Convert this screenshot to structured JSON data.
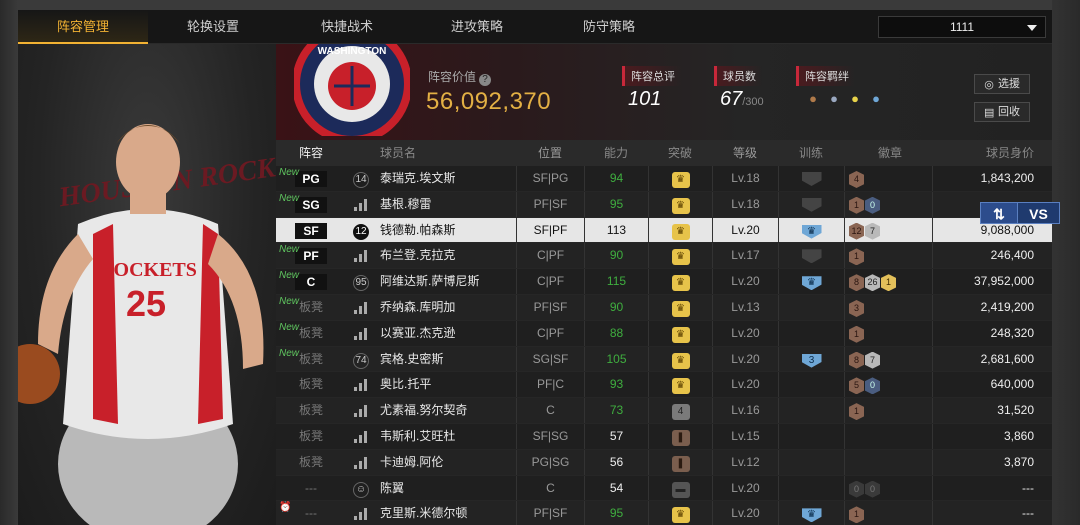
{
  "tabs": [
    {
      "label": "阵容管理",
      "active": true
    },
    {
      "label": "轮换设置",
      "active": false
    },
    {
      "label": "快捷战术",
      "active": false
    },
    {
      "label": "进攻策略",
      "active": false
    },
    {
      "label": "防守策略",
      "active": false
    }
  ],
  "lineup_select": {
    "value": "1111"
  },
  "team": {
    "logo_text": "WASHINGTON",
    "jersey_team": "ROCKETS",
    "jersey_number": "25",
    "bg_text": "HOUSTON ROCKETS"
  },
  "summary": {
    "value_label": "阵容价值",
    "value": "56,092,370",
    "rating_label": "阵容总评",
    "rating": "101",
    "players_label": "球员数",
    "players": "67",
    "players_max": "/300",
    "chem_label": "阵容羁绊"
  },
  "buttons": {
    "scout": "选援",
    "recycle": "回收"
  },
  "columns": [
    "阵容",
    "球员名",
    "位置",
    "能力",
    "突破",
    "等级",
    "训练",
    "徽章",
    "球员身价"
  ],
  "colors": {
    "accent": "#f2b233",
    "value_gold": "#e3b044",
    "ovr_green": "#3fae3f",
    "selected_row": "#e6e6e6",
    "vs_blue": "#2c4c8c"
  },
  "vs": {
    "swap": "⇅",
    "label": "VS"
  },
  "rows": [
    {
      "new": "New",
      "slot": "PG",
      "num": "14",
      "name": "泰瑞克.埃文斯",
      "pos": "SF|PG",
      "ovr": "94",
      "ovr_color": "green",
      "brk": "crown-gold",
      "lv": "Lv.18",
      "train": "dim",
      "badges": [
        {
          "t": "bronze",
          "n": "4"
        }
      ],
      "value": "1,843,200"
    },
    {
      "new": "New",
      "slot": "SG",
      "num": "sig",
      "name": "基根.穆雷",
      "pos": "PF|SF",
      "ovr": "95",
      "ovr_color": "green",
      "brk": "crown-gold",
      "lv": "Lv.18",
      "train": "dim",
      "badges": [
        {
          "t": "bronze",
          "n": "1"
        },
        {
          "t": "blue",
          "n": "0"
        }
      ],
      "value": ""
    },
    {
      "new": "",
      "slot": "SF",
      "num": "12",
      "name": "钱德勒.帕森斯",
      "pos": "SF|PF",
      "ovr": "113",
      "ovr_color": "white",
      "brk": "crown-gold",
      "lv": "Lv.20",
      "train": "blue",
      "badges": [
        {
          "t": "bronze",
          "n": "12"
        },
        {
          "t": "silver",
          "n": "7"
        }
      ],
      "value": "9,088,000",
      "selected": true
    },
    {
      "new": "New",
      "slot": "PF",
      "num": "sig",
      "name": "布兰登.克拉克",
      "pos": "C|PF",
      "ovr": "90",
      "ovr_color": "green",
      "brk": "crown-gold",
      "lv": "Lv.17",
      "train": "dim",
      "badges": [
        {
          "t": "bronze",
          "n": "1"
        }
      ],
      "value": "246,400"
    },
    {
      "new": "New",
      "slot": "C",
      "num": "95",
      "name": "阿维达斯.萨博尼斯",
      "pos": "C|PF",
      "ovr": "115",
      "ovr_color": "green",
      "brk": "crown-gold",
      "lv": "Lv.20",
      "train": "blue",
      "badges": [
        {
          "t": "bronze",
          "n": "8"
        },
        {
          "t": "silver",
          "n": "26"
        },
        {
          "t": "gold",
          "n": "1"
        }
      ],
      "value": "37,952,000"
    },
    {
      "new": "New",
      "slot": "板凳",
      "num": "sig",
      "name": "乔纳森.库明加",
      "pos": "PF|SF",
      "ovr": "90",
      "ovr_color": "green",
      "brk": "crown-gold",
      "lv": "Lv.13",
      "train": "none",
      "badges": [
        {
          "t": "bronze",
          "n": "3"
        }
      ],
      "value": "2,419,200"
    },
    {
      "new": "New",
      "slot": "板凳",
      "num": "sig",
      "name": "以赛亚.杰克逊",
      "pos": "C|PF",
      "ovr": "88",
      "ovr_color": "green",
      "brk": "crown-gold",
      "lv": "Lv.20",
      "train": "none",
      "badges": [
        {
          "t": "bronze",
          "n": "1"
        }
      ],
      "value": "248,320"
    },
    {
      "new": "New",
      "slot": "板凳",
      "num": "74",
      "name": "宾格.史密斯",
      "pos": "SG|SF",
      "ovr": "105",
      "ovr_color": "green",
      "brk": "crown-gold",
      "lv": "Lv.20",
      "train": "blue3",
      "badges": [
        {
          "t": "bronze",
          "n": "8"
        },
        {
          "t": "silver",
          "n": "7"
        }
      ],
      "value": "2,681,600"
    },
    {
      "new": "",
      "slot": "板凳",
      "num": "sig",
      "name": "奥比.托平",
      "pos": "PF|C",
      "ovr": "93",
      "ovr_color": "green",
      "brk": "crown-gold",
      "lv": "Lv.20",
      "train": "none",
      "badges": [
        {
          "t": "bronze",
          "n": "5"
        },
        {
          "t": "blue",
          "n": "0"
        }
      ],
      "value": "640,000"
    },
    {
      "new": "",
      "slot": "板凳",
      "num": "sig",
      "name": "尤素福.努尔契奇",
      "pos": "C",
      "ovr": "73",
      "ovr_color": "green",
      "brk": "crown-grey4",
      "lv": "Lv.16",
      "train": "none",
      "badges": [
        {
          "t": "bronze",
          "n": "1"
        }
      ],
      "value": "31,520"
    },
    {
      "new": "",
      "slot": "板凳",
      "num": "sig",
      "name": "韦斯利.艾旺杜",
      "pos": "SF|SG",
      "ovr": "57",
      "ovr_color": "white",
      "brk": "crown-brown",
      "lv": "Lv.15",
      "train": "none",
      "badges": [],
      "value": "3,860"
    },
    {
      "new": "",
      "slot": "板凳",
      "num": "sig",
      "name": "卡迪姆.阿伦",
      "pos": "PG|SG",
      "ovr": "56",
      "ovr_color": "white",
      "brk": "crown-brown",
      "lv": "Lv.12",
      "train": "none",
      "badges": [],
      "value": "3,870"
    },
    {
      "new": "",
      "slot": "---",
      "num": "person",
      "name": "陈翼",
      "pos": "C",
      "ovr": "54",
      "ovr_color": "white",
      "brk": "crown-dark",
      "lv": "Lv.20",
      "train": "none",
      "badges": [
        {
          "t": "dark",
          "n": "0"
        },
        {
          "t": "dark",
          "n": "0"
        }
      ],
      "value": "---"
    },
    {
      "new": "",
      "slot": "---",
      "num": "sig",
      "name": "克里斯.米德尔顿",
      "pos": "PF|SF",
      "ovr": "95",
      "ovr_color": "green",
      "brk": "crown-gold",
      "lv": "Lv.20",
      "train": "blue",
      "badges": [
        {
          "t": "bronze",
          "n": "1"
        }
      ],
      "value": "---",
      "alarm": true
    }
  ]
}
